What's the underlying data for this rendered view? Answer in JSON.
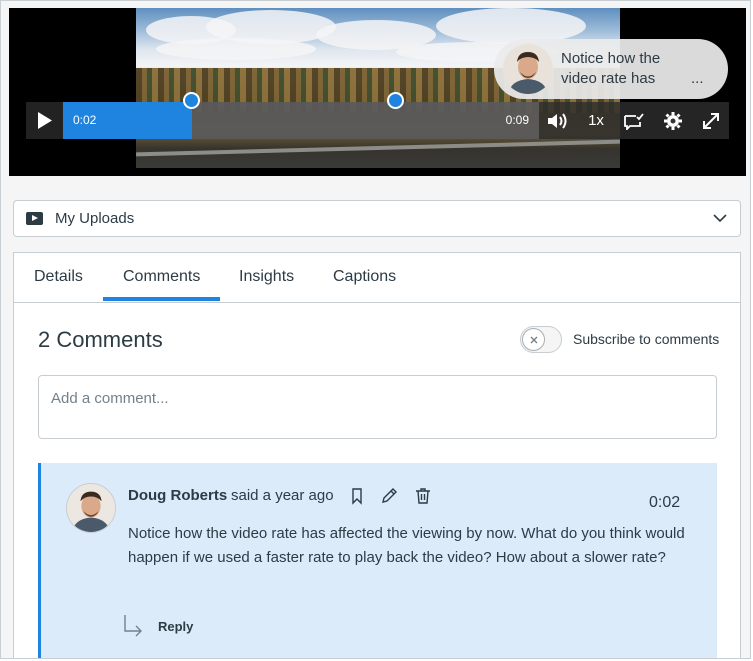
{
  "video": {
    "bubble_text": "Notice how the\nvideo rate has",
    "bubble_ellipsis": "...",
    "current_time": "0:02",
    "duration": "0:09",
    "progress_fraction": 0.27,
    "marker_times_fraction": [
      0.27,
      0.7
    ],
    "speed": "1x",
    "accent_color": "#1f83e0"
  },
  "uploads": {
    "label": "My Uploads",
    "icon": "video-player-icon"
  },
  "tabs": [
    {
      "label": "Details",
      "active": false
    },
    {
      "label": "Comments",
      "active": true
    },
    {
      "label": "Insights",
      "active": false
    },
    {
      "label": "Captions",
      "active": false
    }
  ],
  "comments_section": {
    "count_label": "2 Comments",
    "subscribe_label": "Subscribe to comments",
    "subscribed": false,
    "input_placeholder": "Add a comment..."
  },
  "comment": {
    "author": "Doug Roberts",
    "said": "said a year ago",
    "timestamp": "0:02",
    "text": "Notice how the video rate has affected the viewing by now. What do you think would happen if we used a faster rate to play back the video? How about a slower rate?",
    "reply_label": "Reply",
    "background_color": "#dbebf9"
  }
}
